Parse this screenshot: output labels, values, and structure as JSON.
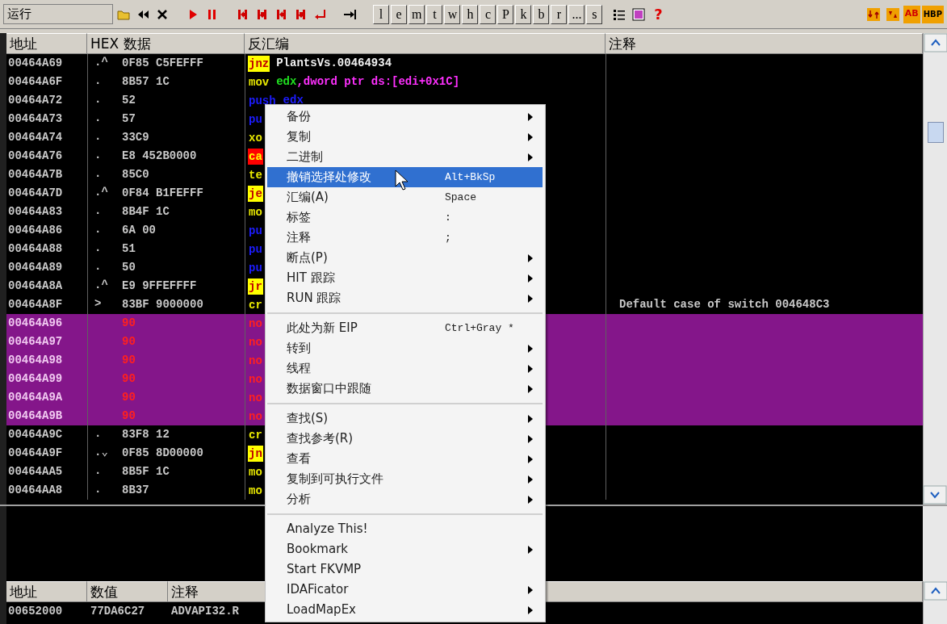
{
  "toolbar": {
    "mode": "运行",
    "letter_buttons": [
      "l",
      "e",
      "m",
      "t",
      "w",
      "h",
      "c",
      "P",
      "k",
      "b",
      "r",
      "...",
      "s"
    ],
    "help": "?",
    "badges": [
      "AB",
      "HBP"
    ]
  },
  "disasm": {
    "columns": [
      "地址",
      "HEX 数据",
      "反汇编",
      "注释"
    ],
    "rows": [
      {
        "address": "00464A69",
        "marker": ".^",
        "hex": "0F85 C5FEFFF",
        "mnemonic": "jnz",
        "kind": "jump",
        "operands": [
          {
            "text": "PlantsVs.00464934",
            "kind": "label"
          }
        ],
        "selected": false
      },
      {
        "address": "00464A6F",
        "marker": ".",
        "hex": "8B57 1C",
        "mnemonic": "mov",
        "kind": "plain",
        "operands": [
          {
            "text": "edx",
            "kind": "register"
          },
          {
            "text": ",dword ptr ds:[edi+0x1C]",
            "kind": "memory"
          }
        ],
        "selected": false
      },
      {
        "address": "00464A72",
        "marker": ".",
        "hex": "52",
        "mnemonic": "push",
        "kind": "push",
        "operands": [
          {
            "text": "edx",
            "kind": "inherit"
          }
        ],
        "selected": false
      },
      {
        "address": "00464A73",
        "marker": ".",
        "hex": "57",
        "mnemonic": "pu",
        "kind": "push",
        "selected": false
      },
      {
        "address": "00464A74",
        "marker": ".",
        "hex": "33C9",
        "mnemonic": "xo",
        "kind": "plain",
        "selected": false
      },
      {
        "address": "00464A76",
        "marker": ".",
        "hex": "E8 452B0000",
        "mnemonic": "ca",
        "kind": "call",
        "selected": false
      },
      {
        "address": "00464A7B",
        "marker": ".",
        "hex": "85C0",
        "mnemonic": "te",
        "kind": "plain",
        "selected": false
      },
      {
        "address": "00464A7D",
        "marker": ".^",
        "hex": "0F84 B1FEFFF",
        "mnemonic": "je",
        "kind": "jump",
        "selected": false
      },
      {
        "address": "00464A83",
        "marker": ".",
        "hex": "8B4F 1C",
        "mnemonic": "mo",
        "kind": "plain",
        "selected": false
      },
      {
        "address": "00464A86",
        "marker": ".",
        "hex": "6A 00",
        "mnemonic": "pu",
        "kind": "push",
        "selected": false
      },
      {
        "address": "00464A88",
        "marker": ".",
        "hex": "51",
        "mnemonic": "pu",
        "kind": "push",
        "selected": false
      },
      {
        "address": "00464A89",
        "marker": ".",
        "hex": "50",
        "mnemonic": "pu",
        "kind": "push",
        "selected": false
      },
      {
        "address": "00464A8A",
        "marker": ".^",
        "hex": "E9 9FFEFFFF",
        "mnemonic": "jr",
        "kind": "jump",
        "selected": false
      },
      {
        "address": "00464A8F",
        "marker": ">",
        "hex": "83BF 9000000",
        "mnemonic": "cr",
        "kind": "plain",
        "comment": "Default case of switch 004648C3",
        "selected": false
      },
      {
        "address": "00464A96",
        "hex": "90",
        "mnemonic": "no",
        "kind": "nop",
        "selected": true
      },
      {
        "address": "00464A97",
        "hex": "90",
        "mnemonic": "no",
        "kind": "nop",
        "selected": true
      },
      {
        "address": "00464A98",
        "hex": "90",
        "mnemonic": "no",
        "kind": "nop",
        "selected": true
      },
      {
        "address": "00464A99",
        "hex": "90",
        "mnemonic": "no",
        "kind": "nop",
        "selected": true
      },
      {
        "address": "00464A9A",
        "hex": "90",
        "mnemonic": "no",
        "kind": "nop",
        "selected": true
      },
      {
        "address": "00464A9B",
        "hex": "90",
        "mnemonic": "no",
        "kind": "nop",
        "selected": true
      },
      {
        "address": "00464A9C",
        "marker": ".",
        "hex": "83F8 12",
        "mnemonic": "cr",
        "kind": "plain",
        "selected": false
      },
      {
        "address": "00464A9F",
        "marker": ".⌄",
        "hex": "0F85 8D00000",
        "mnemonic": "jn",
        "kind": "jump",
        "selected": false
      },
      {
        "address": "00464AA5",
        "marker": ".",
        "hex": "8B5F 1C",
        "mnemonic": "mo",
        "kind": "plain",
        "selected": false
      },
      {
        "address": "00464AA8",
        "marker": ".",
        "hex": "8B37",
        "mnemonic": "mo",
        "kind": "plain",
        "selected": false
      }
    ]
  },
  "stack": {
    "columns": [
      "地址",
      "数值",
      "注释"
    ],
    "rows": [
      {
        "address": "00652000",
        "value": "77DA6C27",
        "comment": "ADVAPI32.R"
      }
    ]
  },
  "context_menu": {
    "items": [
      {
        "kind": "item",
        "label": "备份",
        "submenu": true,
        "selected": false
      },
      {
        "kind": "item",
        "label": "复制",
        "submenu": true,
        "selected": false
      },
      {
        "kind": "item",
        "label": "二进制",
        "submenu": true,
        "selected": false
      },
      {
        "kind": "item",
        "label": "撤销选择处修改",
        "shortcut": "Alt+BkSp",
        "submenu": false,
        "selected": true
      },
      {
        "kind": "item",
        "label": "汇编(A)",
        "shortcut": "Space",
        "submenu": false,
        "selected": false
      },
      {
        "kind": "item",
        "label": "标签",
        "shortcut": ":",
        "submenu": false,
        "selected": false
      },
      {
        "kind": "item",
        "label": "注释",
        "shortcut": ";",
        "submenu": false,
        "selected": false
      },
      {
        "kind": "item",
        "label": "断点(P)",
        "submenu": true,
        "selected": false
      },
      {
        "kind": "item",
        "label": "HIT 跟踪",
        "submenu": true,
        "selected": false
      },
      {
        "kind": "item",
        "label": "RUN 跟踪",
        "submenu": true,
        "selected": false
      },
      {
        "kind": "separator"
      },
      {
        "kind": "item",
        "label": "此处为新 EIP",
        "shortcut": "Ctrl+Gray *",
        "submenu": false,
        "selected": false
      },
      {
        "kind": "item",
        "label": "转到",
        "submenu": true,
        "selected": false
      },
      {
        "kind": "item",
        "label": "线程",
        "submenu": true,
        "selected": false
      },
      {
        "kind": "item",
        "label": "数据窗口中跟随",
        "submenu": true,
        "selected": false
      },
      {
        "kind": "separator"
      },
      {
        "kind": "item",
        "label": "查找(S)",
        "submenu": true,
        "selected": false
      },
      {
        "kind": "item",
        "label": "查找参考(R)",
        "submenu": true,
        "selected": false
      },
      {
        "kind": "item",
        "label": "查看",
        "submenu": true,
        "selected": false
      },
      {
        "kind": "item",
        "label": "复制到可执行文件",
        "submenu": true,
        "selected": false
      },
      {
        "kind": "item",
        "label": "分析",
        "submenu": true,
        "selected": false
      },
      {
        "kind": "separator"
      },
      {
        "kind": "item",
        "label": "Analyze This!",
        "submenu": false,
        "selected": false
      },
      {
        "kind": "item",
        "label": "Bookmark",
        "submenu": true,
        "selected": false
      },
      {
        "kind": "item",
        "label": "Start FKVMP",
        "submenu": false,
        "selected": false
      },
      {
        "kind": "item",
        "label": "IDAFicator",
        "submenu": true,
        "selected": false
      },
      {
        "kind": "item",
        "label": "LoadMapEx",
        "submenu": true,
        "selected": false
      }
    ]
  }
}
